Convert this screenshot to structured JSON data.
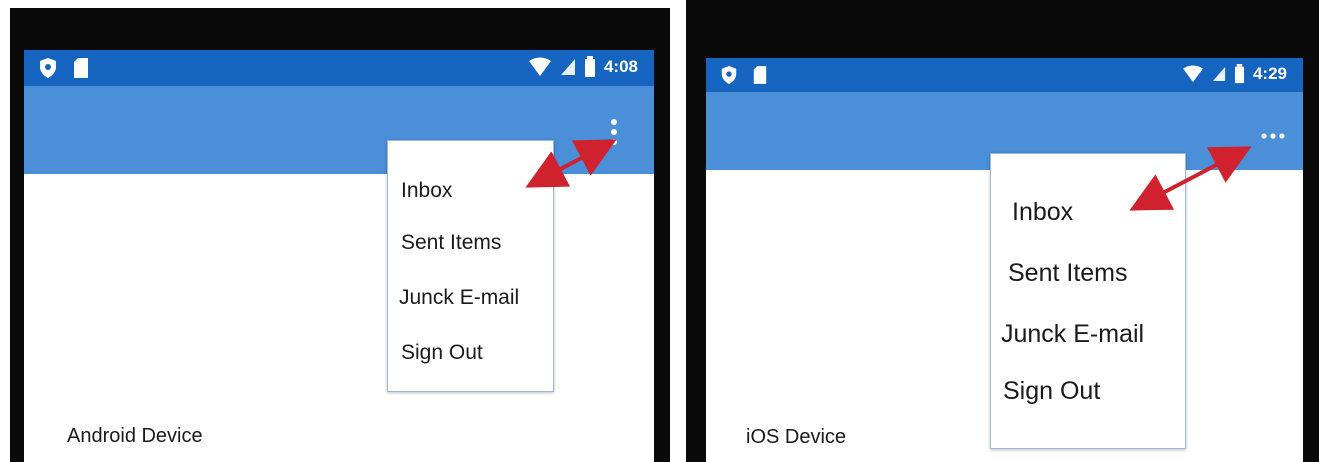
{
  "colors": {
    "status_bar": "#1565c0",
    "app_bar": "#4a8fd8",
    "arrow": "#d0222e",
    "bezel": "#0a0a0a"
  },
  "android": {
    "status_bar": {
      "left_icons": [
        "shield-icon",
        "sim-card-icon"
      ],
      "right_icons": [
        "wifi-icon",
        "cell-signal-icon",
        "battery-icon"
      ],
      "time": "4:08"
    },
    "overflow_icon": "vertical-ellipsis-icon",
    "menu_items": [
      "Inbox",
      "Sent Items",
      "Junck E-mail",
      "Sign Out"
    ],
    "device_label": "Android Device"
  },
  "ios": {
    "status_bar": {
      "left_icons": [
        "shield-icon",
        "sim-card-icon"
      ],
      "right_icons": [
        "wifi-icon",
        "cell-signal-icon",
        "battery-icon"
      ],
      "time": "4:29"
    },
    "overflow_icon": "horizontal-ellipsis-icon",
    "menu_items": [
      "Inbox",
      "Sent Items",
      "Junck E-mail",
      "Sign Out"
    ],
    "device_label": "iOS Device"
  }
}
